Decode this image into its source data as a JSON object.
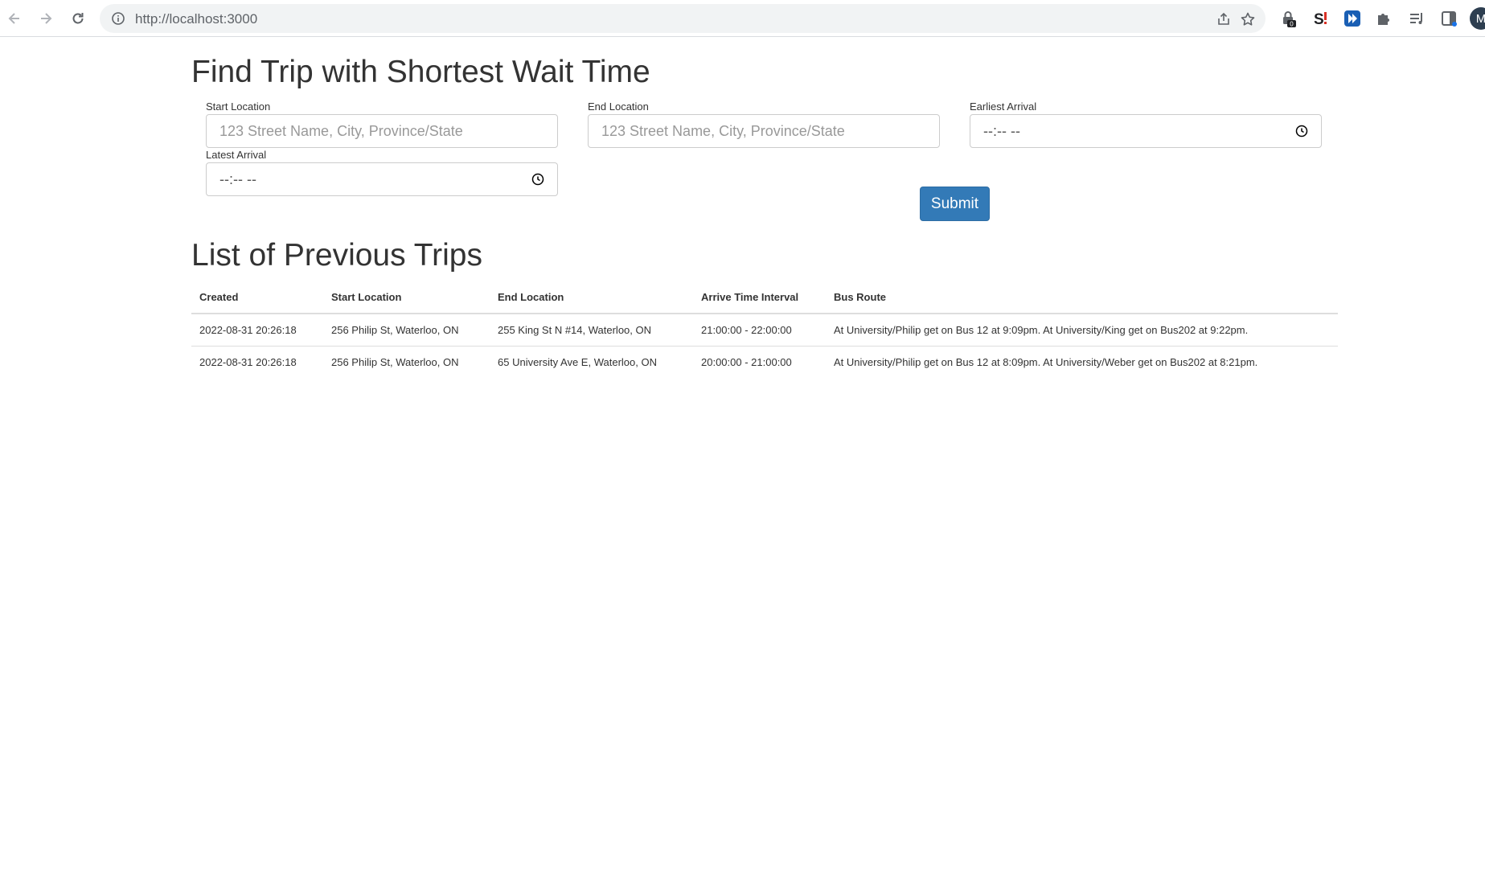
{
  "browser": {
    "url": "http://localhost:3000",
    "avatar_letter": "M",
    "extension_badge": "0"
  },
  "form": {
    "title": "Find Trip with Shortest Wait Time",
    "start_location": {
      "label": "Start Location",
      "placeholder": "123 Street Name, City, Province/State"
    },
    "end_location": {
      "label": "End Location",
      "placeholder": "123 Street Name, City, Province/State"
    },
    "earliest_arrival": {
      "label": "Earliest Arrival",
      "value": "--:-- --"
    },
    "latest_arrival": {
      "label": "Latest Arrival",
      "value": "--:-- --"
    },
    "submit_label": "Submit"
  },
  "trips": {
    "title": "List of Previous Trips",
    "columns": [
      "Created",
      "Start Location",
      "End Location",
      "Arrive Time Interval",
      "Bus Route"
    ],
    "rows": [
      {
        "created": "2022-08-31 20:26:18",
        "start": "256 Philip St, Waterloo, ON",
        "end": "255 King St N #14, Waterloo, ON",
        "interval": "21:00:00 - 22:00:00",
        "route": "At University/Philip get on Bus 12 at 9:09pm. At University/King get on Bus202 at 9:22pm."
      },
      {
        "created": "2022-08-31 20:26:18",
        "start": "256 Philip St, Waterloo, ON",
        "end": "65 University Ave E, Waterloo, ON",
        "interval": "20:00:00 - 21:00:00",
        "route": "At University/Philip get on Bus 12 at 8:09pm. At University/Weber get on Bus202 at 8:21pm."
      }
    ]
  }
}
